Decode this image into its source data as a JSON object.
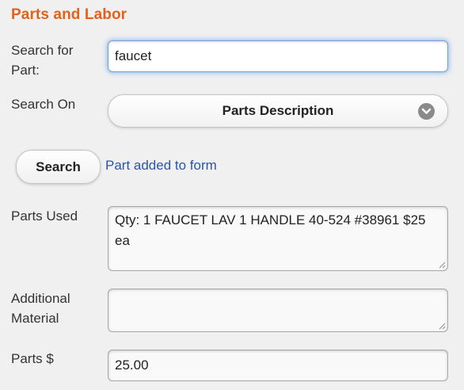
{
  "section": {
    "title": "Parts and Labor"
  },
  "search_part": {
    "label": "Search for Part:",
    "value": "faucet"
  },
  "search_on": {
    "label": "Search On",
    "selected": "Parts Description",
    "arrow_icon": "chevron-down-icon"
  },
  "search_button": {
    "label": "Search"
  },
  "status": {
    "message": "Part added to form",
    "color": "#2a55a8"
  },
  "parts_used": {
    "label": "Parts Used",
    "value": "Qty: 1 FAUCET LAV 1 HANDLE 40-524 #38961 $25 ea"
  },
  "additional_material": {
    "label": "Additional Material",
    "value": ""
  },
  "parts_cost": {
    "label": "Parts $",
    "value": "25.00"
  },
  "colors": {
    "accent": "#e0621c",
    "background": "#f0f0f0",
    "focus": "#388ee8"
  }
}
